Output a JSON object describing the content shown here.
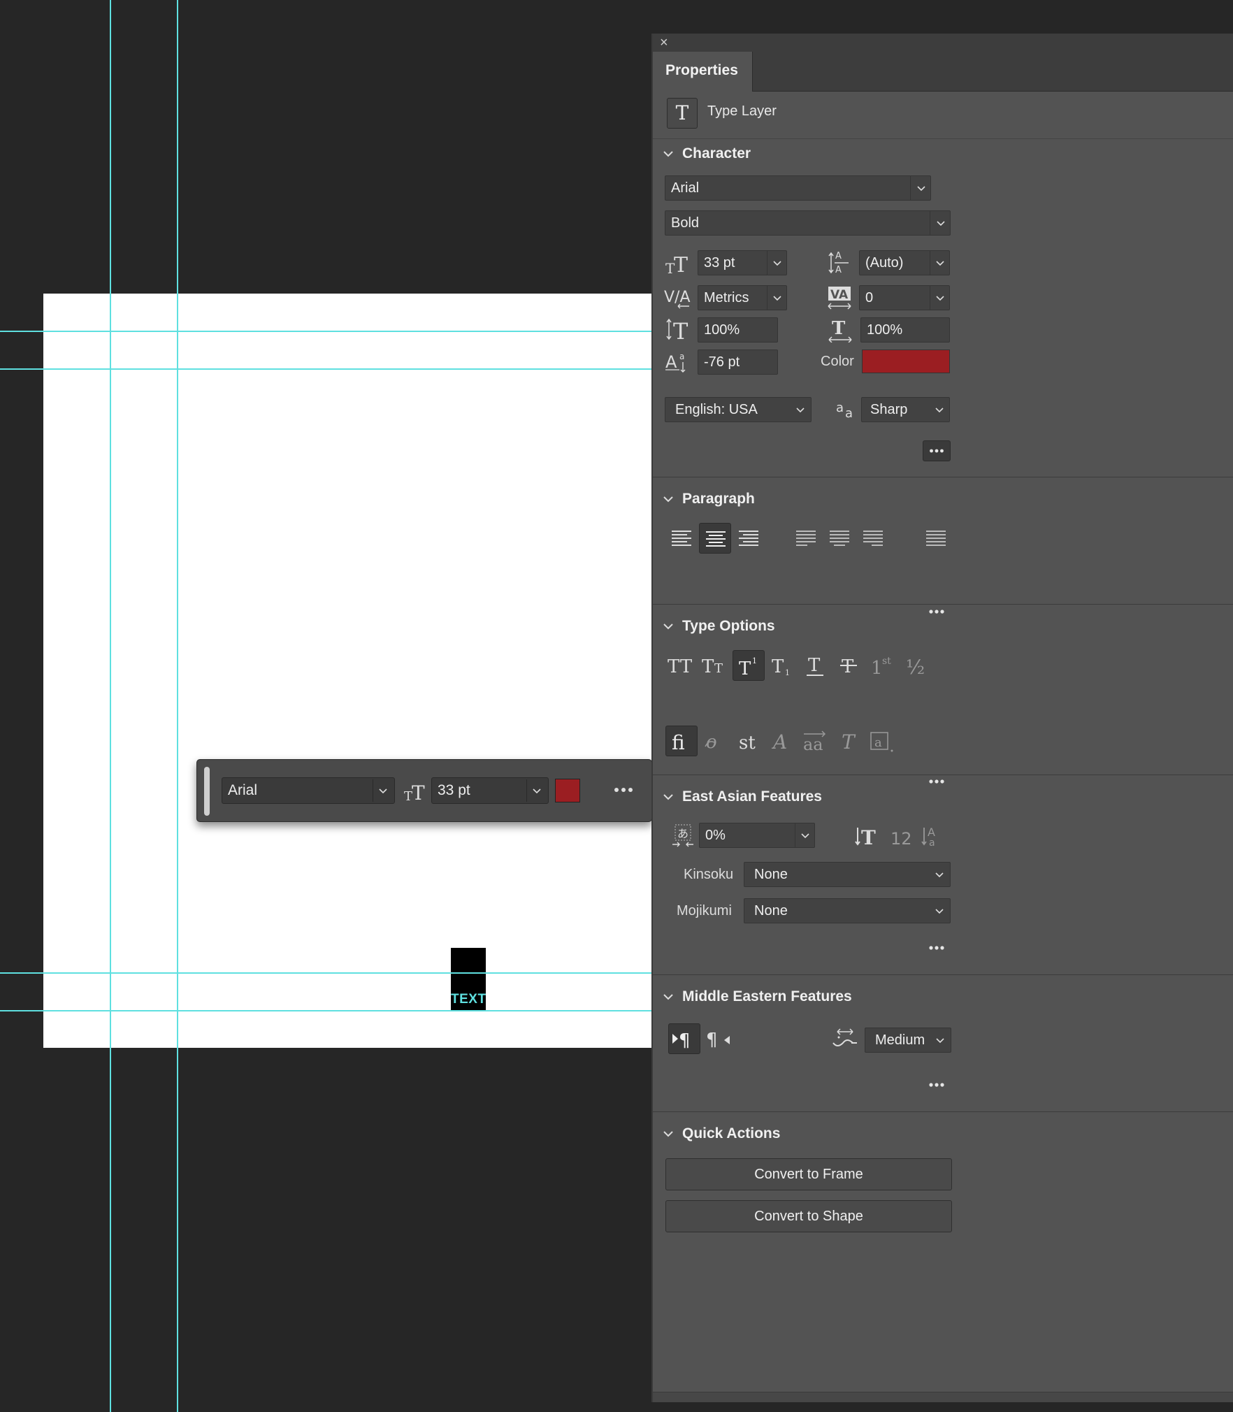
{
  "colors": {
    "accent_guide": "#5fe0e0",
    "text_color": "#9b1e22"
  },
  "canvas": {
    "text_layer_label": "TEXT"
  },
  "context_bar": {
    "font": "Arial",
    "size": "33 pt",
    "more_icon": "ellipsis-icon"
  },
  "panel": {
    "tab": "Properties",
    "layer_type": "Type Layer",
    "character": {
      "title": "Character",
      "font_family": "Arial",
      "font_style": "Bold",
      "size": "33 pt",
      "leading": "(Auto)",
      "kerning": "Metrics",
      "tracking": "0",
      "vertical_scale": "100%",
      "horizontal_scale": "100%",
      "baseline_shift": "-76 pt",
      "color_label": "Color",
      "language": "English: USA",
      "antialias": "Sharp"
    },
    "paragraph": {
      "title": "Paragraph",
      "active_alignment": "center"
    },
    "type_options": {
      "title": "Type Options",
      "superscript_glyph": "st",
      "fraction_glyph": "½"
    },
    "east_asian": {
      "title": "East Asian Features",
      "tsume": "0%",
      "kinsoku_label": "Kinsoku",
      "kinsoku_value": "None",
      "mojikumi_label": "Mojikumi",
      "mojikumi_value": "None",
      "num_glyph": "12"
    },
    "middle_eastern": {
      "title": "Middle Eastern Features",
      "justification": "Medium"
    },
    "quick_actions": {
      "title": "Quick Actions",
      "convert_frame": "Convert to Frame",
      "convert_shape": "Convert to Shape"
    }
  }
}
